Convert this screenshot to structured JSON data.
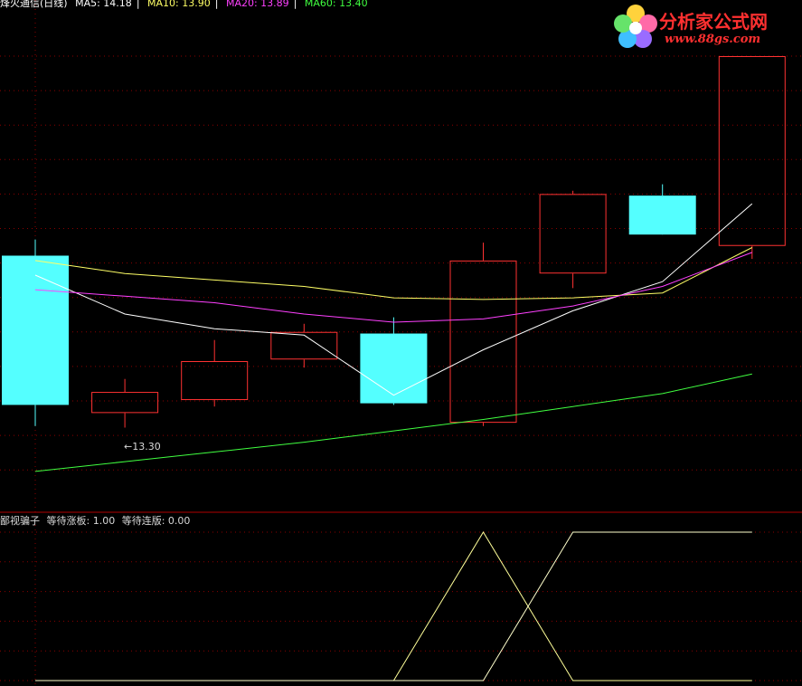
{
  "legend": {
    "title": "烽火通信(日线)",
    "ma": [
      {
        "label": "MA5: 14.18",
        "color": "#ffffff"
      },
      {
        "label": "MA10: 13.90",
        "color": "#ffff66"
      },
      {
        "label": "MA20: 13.89",
        "color": "#ff40ff"
      },
      {
        "label": "MA60: 13.40",
        "color": "#40ff40"
      }
    ]
  },
  "indicator_legend": {
    "name": "鄙视骗子",
    "wait_limit_up": "等待涨板: 1.00",
    "wait_consecutive": "等待连版: 0.00"
  },
  "low_annotation": "←13.30",
  "logo": {
    "title": "分析家公式网",
    "url": "www.88gs.com"
  },
  "colors": {
    "up": "#ff3232",
    "down": "#54ffff",
    "grid": "#8b0000",
    "ma5": "#ffffff",
    "ma10": "#ffff66",
    "ma20": "#ff40ff",
    "ma60": "#40ff40",
    "ind1": "#ffff99",
    "ind2": "#ffffcc"
  },
  "chart_data": [
    {
      "type": "candlestick",
      "price_range": [
        12.9,
        15.6
      ],
      "candles": [
        {
          "open": 14.37,
          "high": 14.47,
          "low": 13.32,
          "close": 13.45,
          "direction": "down"
        },
        {
          "open": 13.4,
          "high": 13.61,
          "low": 13.31,
          "close": 13.53,
          "direction": "up"
        },
        {
          "open": 13.48,
          "high": 13.85,
          "low": 13.44,
          "close": 13.72,
          "direction": "up"
        },
        {
          "open": 13.73,
          "high": 13.95,
          "low": 13.68,
          "close": 13.9,
          "direction": "up"
        },
        {
          "open": 13.89,
          "high": 13.99,
          "low": 13.45,
          "close": 13.46,
          "direction": "down"
        },
        {
          "open": 13.34,
          "high": 14.45,
          "low": 13.32,
          "close": 14.34,
          "direction": "up"
        },
        {
          "open": 14.26,
          "high": 14.77,
          "low": 14.17,
          "close": 14.75,
          "direction": "up"
        },
        {
          "open": 14.74,
          "high": 14.81,
          "low": 14.55,
          "close": 14.5,
          "direction": "down"
        },
        {
          "open": 14.43,
          "high": 15.6,
          "low": 14.35,
          "close": 15.6,
          "direction": "up"
        }
      ],
      "series": [
        {
          "name": "MA5",
          "color": "#ffffff",
          "values": [
            14.25,
            14.01,
            13.92,
            13.88,
            13.51,
            13.79,
            14.03,
            14.21,
            14.69
          ]
        },
        {
          "name": "MA10",
          "color": "#ffff66",
          "values": [
            14.34,
            14.26,
            14.22,
            14.18,
            14.11,
            14.1,
            14.11,
            14.14,
            14.42
          ]
        },
        {
          "name": "MA20",
          "color": "#ff40ff",
          "values": [
            14.16,
            14.12,
            14.08,
            14.01,
            13.96,
            13.98,
            14.06,
            14.18,
            14.39
          ]
        },
        {
          "name": "MA60",
          "color": "#40ff40",
          "values": [
            13.04,
            13.1,
            13.16,
            13.22,
            13.29,
            13.36,
            13.44,
            13.52,
            13.64
          ]
        }
      ]
    },
    {
      "type": "line",
      "y_range": [
        0,
        1
      ],
      "series": [
        {
          "name": "等待涨板",
          "color": "#ffff99",
          "values": [
            0,
            0,
            0,
            0,
            0,
            1,
            0,
            0,
            0
          ]
        },
        {
          "name": "等待连版",
          "color": "#ffffcc",
          "values": [
            0,
            0,
            0,
            0,
            0,
            0,
            1,
            1,
            1
          ]
        }
      ]
    }
  ]
}
